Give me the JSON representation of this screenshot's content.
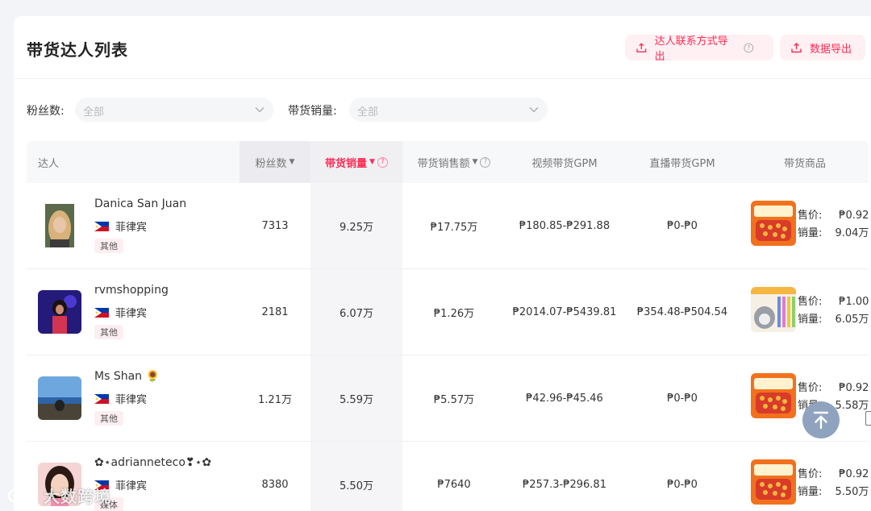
{
  "page": {
    "title": "带货达人列表",
    "buttons": {
      "contact_export": "达人联系方式导出",
      "data_export": "数据导出"
    }
  },
  "filters": [
    {
      "label": "粉丝数:",
      "placeholder": "全部"
    },
    {
      "label": "带货销量:",
      "placeholder": "全部"
    }
  ],
  "table": {
    "headers": {
      "influencer": "达人",
      "fans": "粉丝数",
      "sales": "带货销量",
      "revenue": "带货销售额",
      "video_gpm": "视频带货GPM",
      "live_gpm": "直播带货GPM",
      "products": "带货商品"
    },
    "price_label": "售价:",
    "sales_label": "销量:",
    "rows": [
      {
        "name": "Danica San Juan",
        "country": "菲律宾",
        "tag": "其他",
        "fans": "7313",
        "sales": "9.25万",
        "revenue": "₱17.75万",
        "video_gpm": "₱180.85-₱291.88",
        "live_gpm": "₱0-₱0",
        "price": "₱0.92",
        "product_sales": "9.04万",
        "avatar": "blonde-portrait",
        "product": "snack"
      },
      {
        "name": "rvmshopping",
        "country": "菲律宾",
        "tag": "其他",
        "fans": "2181",
        "sales": "6.07万",
        "revenue": "₱1.26万",
        "video_gpm": "₱2014.07-₱5439.81",
        "live_gpm": "₱354.48-₱504.54",
        "price": "₱1.00",
        "product_sales": "6.05万",
        "avatar": "night-portrait",
        "product": "cat-treats"
      },
      {
        "name": "Ms Shan 🌻",
        "country": "菲律宾",
        "tag": "其他",
        "fans": "1.21万",
        "sales": "5.59万",
        "revenue": "₱5.57万",
        "video_gpm": "₱42.96-₱45.46",
        "live_gpm": "₱0-₱0",
        "price": "₱0.92",
        "product_sales": "5.58万",
        "avatar": "beach-portrait",
        "product": "snack"
      },
      {
        "name": "✿⋆adrianneteco❣⋆✿",
        "country": "菲律宾",
        "tag": "媒体",
        "fans": "8380",
        "sales": "5.50万",
        "revenue": "₱7640",
        "video_gpm": "₱257.3-₱296.81",
        "live_gpm": "₱0-₱0",
        "price": "₱0.92",
        "product_sales": "5.50万",
        "avatar": "pink-portrait",
        "product": "snack"
      }
    ]
  },
  "watermark": "大数跨境",
  "colors": {
    "accent": "#ff2d55",
    "accent_bg": "#fff0f3",
    "to_top": "#8fa3bf"
  }
}
